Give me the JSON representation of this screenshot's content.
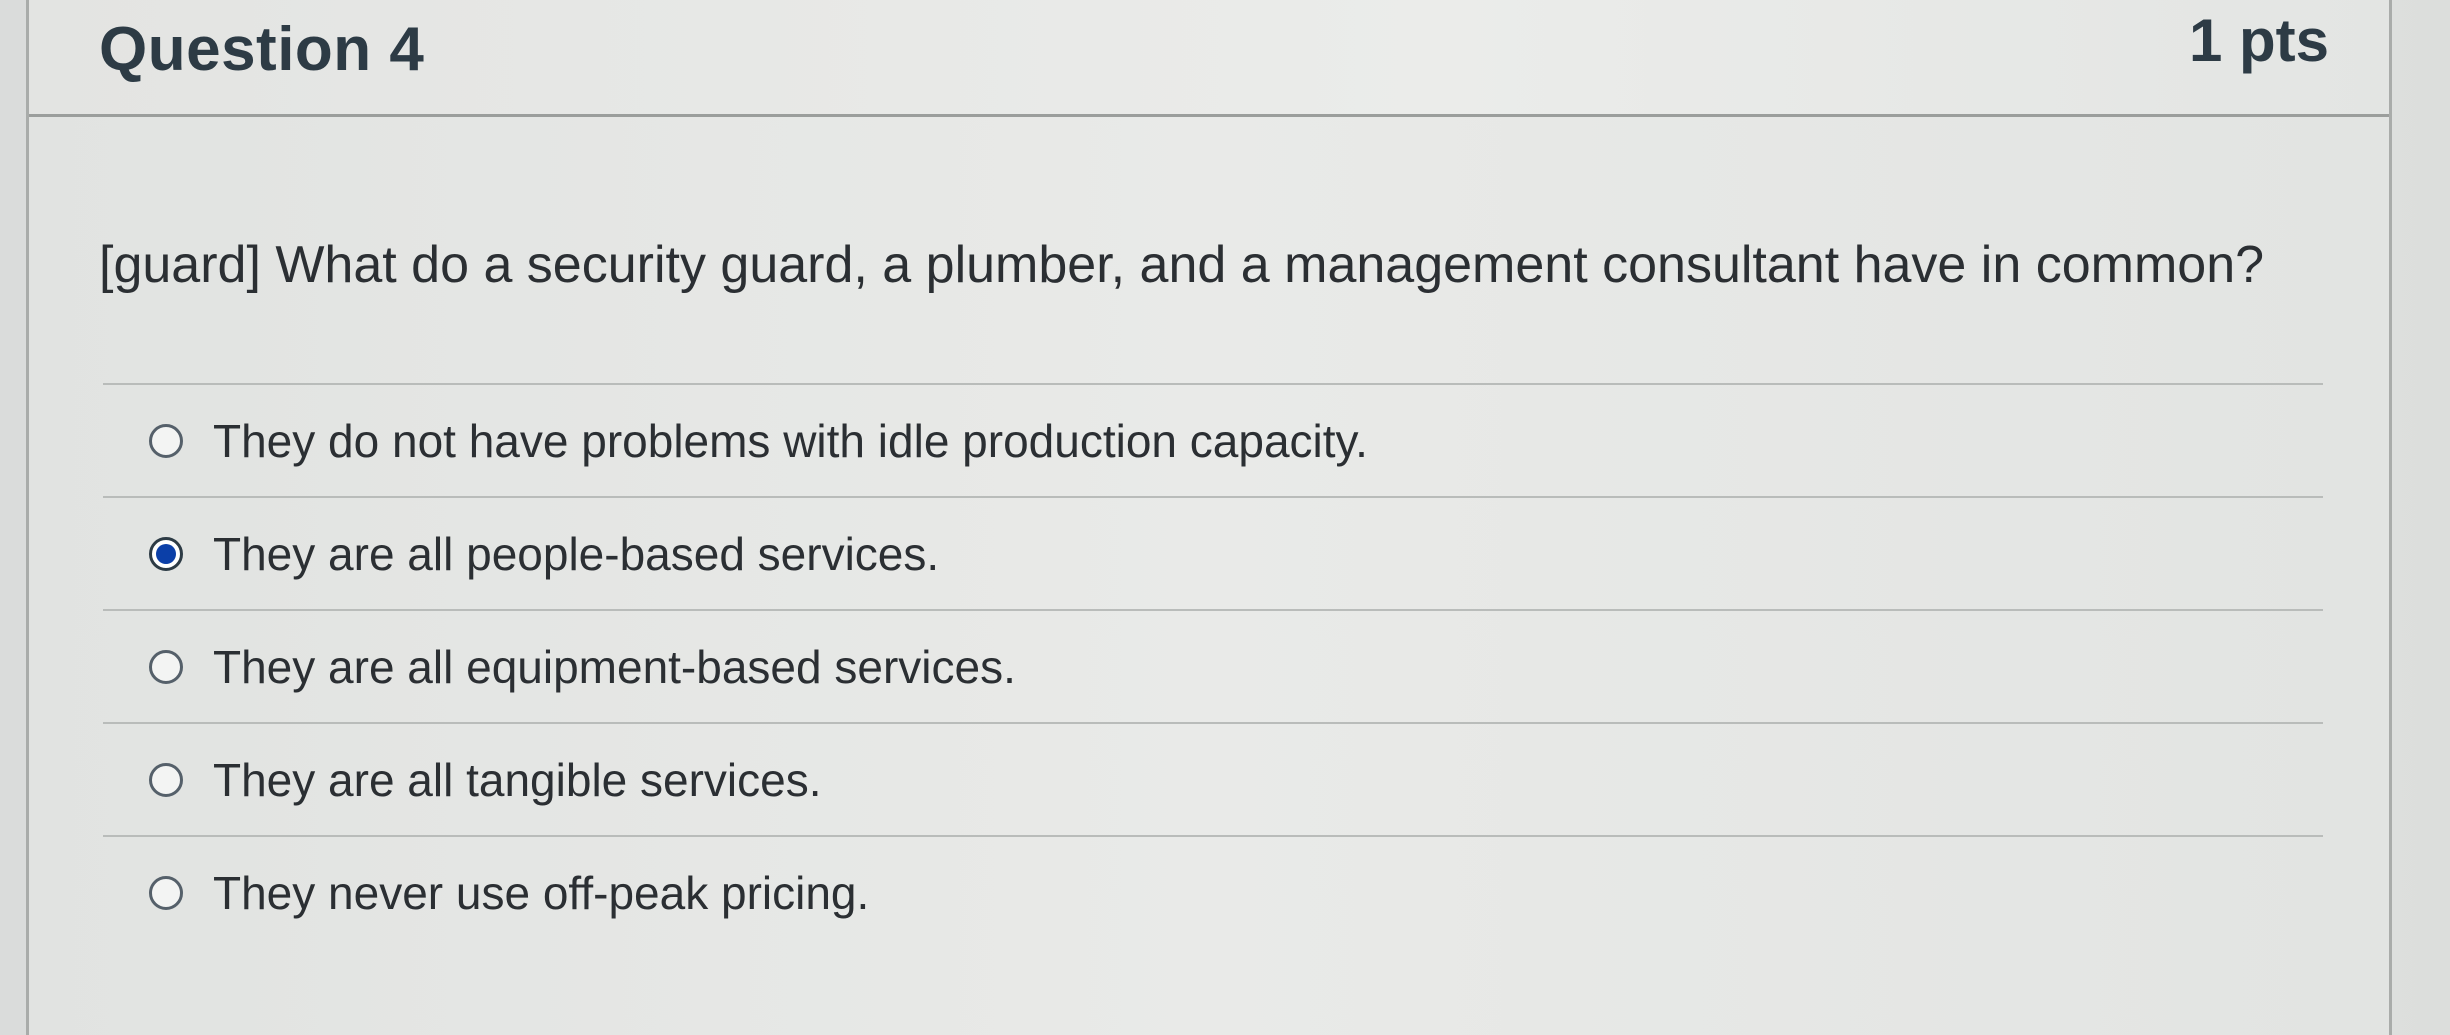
{
  "question": {
    "title": "Question 4",
    "points": "1 pts",
    "text": "[guard] What do a security guard, a plumber, and a management consultant have in common?"
  },
  "answers": [
    {
      "label": "They do not have problems with idle production capacity.",
      "selected": false
    },
    {
      "label": "They are all people-based services.",
      "selected": true
    },
    {
      "label": "They are all equipment-based services.",
      "selected": false
    },
    {
      "label": "They are all tangible services.",
      "selected": false
    },
    {
      "label": "They never use off-peak pricing.",
      "selected": false
    }
  ],
  "colors": {
    "heading_text": "#2d3b45",
    "selected_radio": "#0b3fa8"
  }
}
